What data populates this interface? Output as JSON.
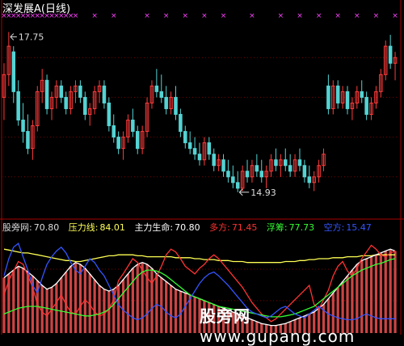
{
  "header": {
    "title": "深发展A",
    "period": "(日线)"
  },
  "annotations": {
    "high_label": "17.75",
    "low_label": "14.93"
  },
  "indicator": {
    "name": "股旁网",
    "name_sep": ":",
    "value": "70.80",
    "items": [
      {
        "label": "压力线:",
        "value": "84.01",
        "color": "#ffff55"
      },
      {
        "label": "主力生命:",
        "value": "70.80",
        "color": "#ffffff"
      },
      {
        "label": "多方:",
        "value": "71.45",
        "color": "#ff3333"
      },
      {
        "label": "浮筹:",
        "value": "77.73",
        "color": "#33ff33"
      },
      {
        "label": "空方:",
        "value": "15.47",
        "color": "#3355ff"
      }
    ]
  },
  "watermark": {
    "cn": "股旁网",
    "url": "www.gupang.com"
  },
  "colors": {
    "up": "#ff3b3b",
    "down": "#54d3d3",
    "marker": "#ff44ff",
    "pressure": "#ffff55",
    "life": "#ffffff",
    "bull": "#ff3333",
    "float": "#33ff33",
    "bear": "#3355ff",
    "grid": "#7a0000",
    "border": "#aa0000",
    "label": "#dddddd"
  },
  "chart_data": [
    {
      "type": "candlestick",
      "title": "深发展A (日线)",
      "ylim": [
        14.5,
        18.0
      ],
      "annotations": [
        {
          "label": "17.75",
          "kind": "high"
        },
        {
          "label": "14.93",
          "kind": "low"
        }
      ],
      "candles": [
        [
          16.6,
          17.2,
          16.2,
          17.0
        ],
        [
          17.0,
          17.75,
          16.8,
          17.5
        ],
        [
          17.4,
          17.5,
          16.5,
          16.7
        ],
        [
          16.7,
          16.9,
          16.1,
          16.2
        ],
        [
          16.2,
          16.5,
          15.8,
          16.0
        ],
        [
          16.0,
          16.3,
          15.6,
          15.7
        ],
        [
          15.7,
          16.2,
          15.5,
          16.1
        ],
        [
          16.1,
          16.8,
          16.0,
          16.7
        ],
        [
          16.7,
          17.1,
          16.5,
          16.9
        ],
        [
          16.9,
          17.0,
          16.3,
          16.4
        ],
        [
          16.4,
          16.7,
          16.2,
          16.6
        ],
        [
          16.6,
          16.9,
          16.4,
          16.8
        ],
        [
          16.8,
          16.9,
          16.5,
          16.6
        ],
        [
          16.6,
          16.7,
          16.3,
          16.4
        ],
        [
          16.4,
          16.8,
          16.3,
          16.7
        ],
        [
          16.7,
          16.9,
          16.5,
          16.8
        ],
        [
          16.8,
          16.9,
          16.5,
          16.6
        ],
        [
          16.6,
          16.7,
          16.2,
          16.3
        ],
        [
          16.3,
          16.5,
          16.1,
          16.4
        ],
        [
          16.4,
          16.8,
          16.3,
          16.7
        ],
        [
          16.7,
          16.9,
          16.5,
          16.8
        ],
        [
          16.8,
          16.9,
          16.4,
          16.5
        ],
        [
          16.5,
          16.6,
          16.0,
          16.1
        ],
        [
          16.1,
          16.3,
          15.8,
          15.9
        ],
        [
          15.9,
          16.0,
          15.6,
          15.7
        ],
        [
          15.7,
          16.0,
          15.5,
          15.9
        ],
        [
          15.9,
          16.3,
          15.8,
          16.2
        ],
        [
          16.2,
          16.4,
          15.9,
          16.0
        ],
        [
          16.0,
          16.1,
          15.6,
          15.7
        ],
        [
          15.7,
          16.1,
          15.6,
          16.0
        ],
        [
          16.0,
          16.6,
          15.9,
          16.5
        ],
        [
          16.5,
          16.9,
          16.4,
          16.8
        ],
        [
          16.8,
          17.1,
          16.6,
          16.7
        ],
        [
          16.7,
          17.0,
          16.5,
          16.6
        ],
        [
          16.6,
          16.8,
          16.3,
          16.4
        ],
        [
          16.4,
          16.7,
          16.3,
          16.6
        ],
        [
          16.6,
          16.8,
          16.2,
          16.3
        ],
        [
          16.3,
          16.4,
          15.9,
          16.0
        ],
        [
          16.0,
          16.1,
          15.7,
          15.8
        ],
        [
          15.8,
          16.0,
          15.6,
          15.7
        ],
        [
          15.7,
          15.9,
          15.5,
          15.6
        ],
        [
          15.6,
          15.8,
          15.4,
          15.5
        ],
        [
          15.5,
          15.9,
          15.4,
          15.8
        ],
        [
          15.8,
          15.9,
          15.5,
          15.6
        ],
        [
          15.6,
          15.7,
          15.3,
          15.4
        ],
        [
          15.4,
          15.6,
          15.3,
          15.5
        ],
        [
          15.5,
          15.6,
          15.2,
          15.3
        ],
        [
          15.3,
          15.5,
          15.1,
          15.2
        ],
        [
          15.2,
          15.4,
          15.0,
          15.1
        ],
        [
          15.1,
          15.3,
          14.93,
          15.0
        ],
        [
          15.0,
          15.4,
          14.95,
          15.3
        ],
        [
          15.3,
          15.5,
          15.1,
          15.2
        ],
        [
          15.2,
          15.5,
          15.1,
          15.4
        ],
        [
          15.4,
          15.6,
          15.2,
          15.3
        ],
        [
          15.3,
          15.5,
          15.1,
          15.2
        ],
        [
          15.2,
          15.4,
          15.0,
          15.3
        ],
        [
          15.3,
          15.6,
          15.2,
          15.5
        ],
        [
          15.5,
          15.7,
          15.3,
          15.4
        ],
        [
          15.4,
          15.6,
          15.2,
          15.5
        ],
        [
          15.5,
          15.7,
          15.3,
          15.4
        ],
        [
          15.4,
          15.6,
          15.2,
          15.3
        ],
        [
          15.3,
          15.6,
          15.2,
          15.5
        ],
        [
          15.5,
          15.7,
          15.3,
          15.4
        ],
        [
          15.4,
          15.5,
          15.1,
          15.2
        ],
        [
          15.2,
          15.4,
          15.0,
          15.1
        ],
        [
          15.1,
          15.3,
          14.95,
          15.2
        ],
        [
          15.2,
          15.5,
          15.1,
          15.4
        ],
        [
          15.4,
          15.7,
          15.3,
          15.6
        ],
        [
          16.8,
          17.0,
          16.3,
          16.4
        ],
        [
          16.4,
          16.9,
          16.3,
          16.8
        ],
        [
          16.8,
          16.9,
          16.4,
          16.5
        ],
        [
          16.5,
          16.8,
          16.4,
          16.7
        ],
        [
          16.7,
          16.8,
          16.3,
          16.4
        ],
        [
          16.4,
          16.6,
          16.2,
          16.5
        ],
        [
          16.5,
          16.8,
          16.4,
          16.7
        ],
        [
          16.7,
          16.9,
          16.5,
          16.6
        ],
        [
          16.6,
          16.7,
          16.2,
          16.3
        ],
        [
          16.3,
          16.6,
          16.2,
          16.5
        ],
        [
          16.5,
          16.8,
          16.4,
          16.7
        ],
        [
          16.7,
          17.1,
          16.6,
          17.0
        ],
        [
          17.0,
          17.6,
          16.9,
          17.5
        ],
        [
          17.5,
          17.7,
          17.1,
          17.2
        ],
        [
          17.2,
          17.4,
          16.9,
          17.3
        ]
      ],
      "markers": [
        0,
        1,
        2,
        3,
        4,
        5,
        6,
        7,
        8,
        9,
        10,
        11,
        12,
        13,
        14,
        15,
        19,
        23,
        30,
        34,
        38,
        42,
        46,
        52,
        58,
        62,
        66,
        70,
        74,
        78,
        82
      ]
    },
    {
      "type": "line",
      "ylim": [
        0,
        100
      ],
      "columns": [
        58,
        62,
        66,
        70,
        68,
        64,
        60,
        55,
        50,
        46,
        48,
        52,
        58,
        64,
        70,
        74,
        72,
        68,
        62,
        56,
        50,
        46,
        44,
        46,
        50,
        56,
        62,
        68,
        72,
        74,
        72,
        68,
        62,
        58,
        54,
        50,
        46,
        44,
        42,
        40,
        38,
        36,
        34,
        32,
        30,
        28,
        26,
        24,
        22,
        20,
        18,
        16,
        14,
        12,
        10,
        9,
        8,
        8,
        9,
        10,
        12,
        14,
        16,
        18,
        20,
        22,
        26,
        30,
        36,
        42,
        48,
        54,
        60,
        66,
        72,
        76,
        78,
        80,
        82,
        84,
        86,
        88,
        86
      ],
      "series": [
        {
          "name": "压力线",
          "values": [
            88,
            87,
            86,
            85,
            84,
            84,
            83,
            82,
            81,
            80,
            79,
            78,
            77,
            76,
            76,
            75,
            75,
            76,
            77,
            78,
            79,
            80,
            81,
            81,
            82,
            82,
            82,
            82,
            81,
            81,
            80,
            80,
            80,
            80,
            80,
            80,
            79,
            79,
            79,
            79,
            78,
            78,
            77,
            77,
            77,
            76,
            76,
            76,
            75,
            75,
            75,
            74,
            74,
            74,
            74,
            74,
            74,
            74,
            74,
            75,
            75,
            75,
            76,
            76,
            77,
            77,
            78,
            78,
            78,
            79,
            79,
            79,
            80,
            80,
            80,
            81,
            81,
            81,
            82,
            82,
            82,
            82,
            82
          ]
        },
        {
          "name": "主力生命",
          "values": [
            58,
            62,
            66,
            70,
            68,
            64,
            60,
            55,
            50,
            46,
            48,
            52,
            58,
            64,
            70,
            74,
            72,
            68,
            62,
            56,
            50,
            46,
            44,
            46,
            50,
            56,
            62,
            68,
            72,
            74,
            72,
            68,
            62,
            58,
            54,
            50,
            46,
            44,
            42,
            40,
            38,
            36,
            34,
            32,
            30,
            28,
            26,
            24,
            22,
            20,
            18,
            16,
            14,
            12,
            10,
            9,
            8,
            8,
            9,
            10,
            12,
            14,
            16,
            18,
            20,
            22,
            26,
            30,
            36,
            42,
            48,
            54,
            60,
            66,
            72,
            76,
            78,
            80,
            82,
            84,
            86,
            88,
            86
          ]
        },
        {
          "name": "多方",
          "values": [
            40,
            55,
            65,
            75,
            72,
            60,
            48,
            30,
            22,
            18,
            25,
            32,
            40,
            30,
            22,
            20,
            28,
            35,
            30,
            22,
            18,
            20,
            25,
            35,
            55,
            62,
            70,
            78,
            74,
            66,
            58,
            52,
            60,
            70,
            82,
            88,
            85,
            78,
            70,
            66,
            62,
            68,
            72,
            78,
            82,
            78,
            72,
            66,
            60,
            54,
            48,
            40,
            32,
            26,
            20,
            16,
            12,
            15,
            20,
            25,
            30,
            35,
            40,
            45,
            50,
            30,
            25,
            35,
            45,
            60,
            70,
            75,
            65,
            60,
            68,
            78,
            85,
            92,
            88,
            82,
            80,
            84,
            86
          ]
        },
        {
          "name": "浮筹",
          "values": [
            20,
            22,
            24,
            26,
            27,
            28,
            28,
            28,
            27,
            26,
            25,
            24,
            23,
            22,
            21,
            20,
            19,
            18,
            18,
            19,
            20,
            22,
            25,
            30,
            36,
            42,
            48,
            54,
            60,
            64,
            66,
            66,
            65,
            63,
            60,
            56,
            52,
            48,
            44,
            40,
            38,
            36,
            34,
            32,
            30,
            28,
            27,
            26,
            25,
            24,
            23,
            22,
            21,
            20,
            19,
            18,
            17,
            17,
            17,
            18,
            19,
            20,
            22,
            24,
            26,
            28,
            32,
            36,
            40,
            44,
            48,
            52,
            56,
            60,
            63,
            66,
            68,
            70,
            72,
            73,
            75,
            77,
            78
          ]
        },
        {
          "name": "空方",
          "values": [
            60,
            78,
            90,
            94,
            80,
            66,
            50,
            42,
            58,
            72,
            80,
            86,
            90,
            84,
            74,
            66,
            62,
            70,
            78,
            74,
            66,
            60,
            50,
            40,
            30,
            24,
            20,
            16,
            14,
            16,
            20,
            26,
            30,
            28,
            22,
            18,
            16,
            20,
            28,
            36,
            44,
            52,
            58,
            62,
            64,
            60,
            55,
            50,
            44,
            38,
            32,
            26,
            22,
            20,
            18,
            16,
            18,
            22,
            26,
            28,
            24,
            20,
            18,
            16,
            20,
            24,
            28,
            24,
            20,
            18,
            16,
            15,
            14,
            14,
            15,
            18,
            20,
            18,
            16,
            15,
            15,
            15,
            15
          ]
        }
      ]
    }
  ]
}
